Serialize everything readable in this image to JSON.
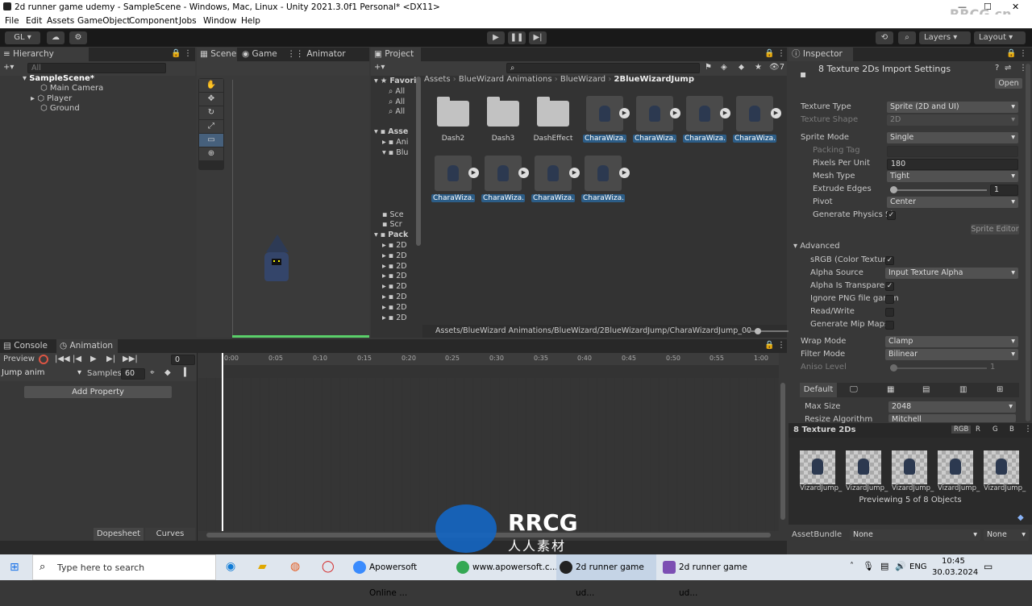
{
  "window": {
    "title": "2d runner game udemy - SampleScene - Windows, Mac, Linux - Unity 2021.3.0f1 Personal* <DX11>"
  },
  "watermark_top": "RRCG.cn",
  "menu": [
    "File",
    "Edit",
    "Assets",
    "GameObject",
    "Component",
    "Jobs",
    "Window",
    "Help"
  ],
  "toolbar": {
    "account": "GL",
    "layers": "Layers",
    "layout": "Layout"
  },
  "hierarchy": {
    "tab": "Hierarchy",
    "search": "All",
    "scene": "SampleScene*",
    "items": [
      "Main Camera",
      "Player",
      "Ground"
    ]
  },
  "scene_tabs": [
    "Scene",
    "Game",
    "Animator"
  ],
  "project": {
    "tab": "Project",
    "badge": "7",
    "tree": {
      "favorites": "Favori",
      "fav_items": [
        "All",
        "All",
        "All"
      ],
      "assets": "Asse",
      "assets_items": [
        "Ani",
        "Blu"
      ],
      "scenes": [
        "Sce",
        "Scr"
      ],
      "packages": "Pack",
      "package_items": [
        "2D",
        "2D",
        "2D",
        "2D",
        "2D",
        "2D",
        "2D",
        "2D"
      ]
    },
    "breadcrumb": [
      "Assets",
      "BlueWizard Animations",
      "BlueWizard",
      "2BlueWizardJump"
    ],
    "folders": [
      "Dash2",
      "Dash3",
      "DashEffect"
    ],
    "sprites_row1": [
      "CharaWiza...",
      "CharaWiza...",
      "CharaWiza...",
      "CharaWiza..."
    ],
    "sprites_row2": [
      "CharaWiza...",
      "CharaWiza...",
      "CharaWiza...",
      "CharaWiza..."
    ],
    "path": "Assets/BlueWizard Animations/BlueWizard/2BlueWizardJump/CharaWizardJump_00"
  },
  "bottom_tabs": [
    "Console",
    "Animation"
  ],
  "animation": {
    "preview": "Preview",
    "frame": "0",
    "clip": "Jump anim",
    "samples_label": "Samples",
    "samples": "60",
    "add_property": "Add Property",
    "ticks": [
      "0:00",
      "0:05",
      "0:10",
      "0:15",
      "0:20",
      "0:25",
      "0:30",
      "0:35",
      "0:40",
      "0:45",
      "0:50",
      "0:55",
      "1:00"
    ],
    "dopesheet": "Dopesheet",
    "curves": "Curves"
  },
  "inspector": {
    "tab": "Inspector",
    "title": "8 Texture 2Ds Import Settings",
    "open": "Open",
    "rows": [
      {
        "label": "Texture Type",
        "value": "Sprite (2D and UI)",
        "kind": "drop"
      },
      {
        "label": "Texture Shape",
        "value": "2D",
        "kind": "drop-dim"
      },
      {
        "label": "Sprite Mode",
        "value": "Single",
        "kind": "drop"
      },
      {
        "label": "Packing Tag",
        "value": "",
        "kind": "field-dim"
      },
      {
        "label": "Pixels Per Unit",
        "value": "180",
        "kind": "field"
      },
      {
        "label": "Mesh Type",
        "value": "Tight",
        "kind": "drop"
      },
      {
        "label": "Extrude Edges",
        "value": "1",
        "kind": "slider"
      },
      {
        "label": "Pivot",
        "value": "Center",
        "kind": "drop"
      },
      {
        "label": "Generate Physics Sh",
        "value": "✓",
        "kind": "check"
      }
    ],
    "sprite_editor": "Sprite Editor",
    "advanced": "Advanced",
    "adv_rows": [
      {
        "label": "sRGB (Color Texture",
        "value": "✓",
        "kind": "check"
      },
      {
        "label": "Alpha Source",
        "value": "Input Texture Alpha",
        "kind": "drop"
      },
      {
        "label": "Alpha Is Transparenc",
        "value": "✓",
        "kind": "check"
      },
      {
        "label": "Ignore PNG file gamm",
        "value": "",
        "kind": "check"
      },
      {
        "label": "Read/Write",
        "value": "",
        "kind": "check"
      },
      {
        "label": "Generate Mip Maps",
        "value": "",
        "kind": "check"
      }
    ],
    "wrap_rows": [
      {
        "label": "Wrap Mode",
        "value": "Clamp",
        "kind": "drop"
      },
      {
        "label": "Filter Mode",
        "value": "Bilinear",
        "kind": "drop"
      },
      {
        "label": "Aniso Level",
        "value": "1",
        "kind": "slider-dim"
      }
    ],
    "platform_default": "Default",
    "max_size_label": "Max Size",
    "max_size": "2048",
    "resize_label": "Resize Algorithm",
    "resize": "Mitchell",
    "preview_title": "8 Texture 2Ds",
    "channels": [
      "RGB",
      "R",
      "G",
      "B"
    ],
    "thumbs": [
      "VizardJump_",
      "VizardJump_",
      "VizardJump_",
      "VizardJump_",
      "VizardJump_"
    ],
    "previewing": "Previewing 5 of 8 Objects",
    "assetbundle_label": "AssetBundle",
    "assetbundle": "None",
    "assetbundle_variant": "None"
  },
  "taskbar": {
    "search": "Type here to search",
    "apps": [
      "Apowersoft Online ...",
      "www.apowersoft.c...",
      "2d runner game ud...",
      "2d runner game ud..."
    ],
    "lang": "ENG",
    "time": "10:45",
    "date": "30.03.2024"
  },
  "logo": {
    "big": "RRCG",
    "sub": "人人素材"
  }
}
